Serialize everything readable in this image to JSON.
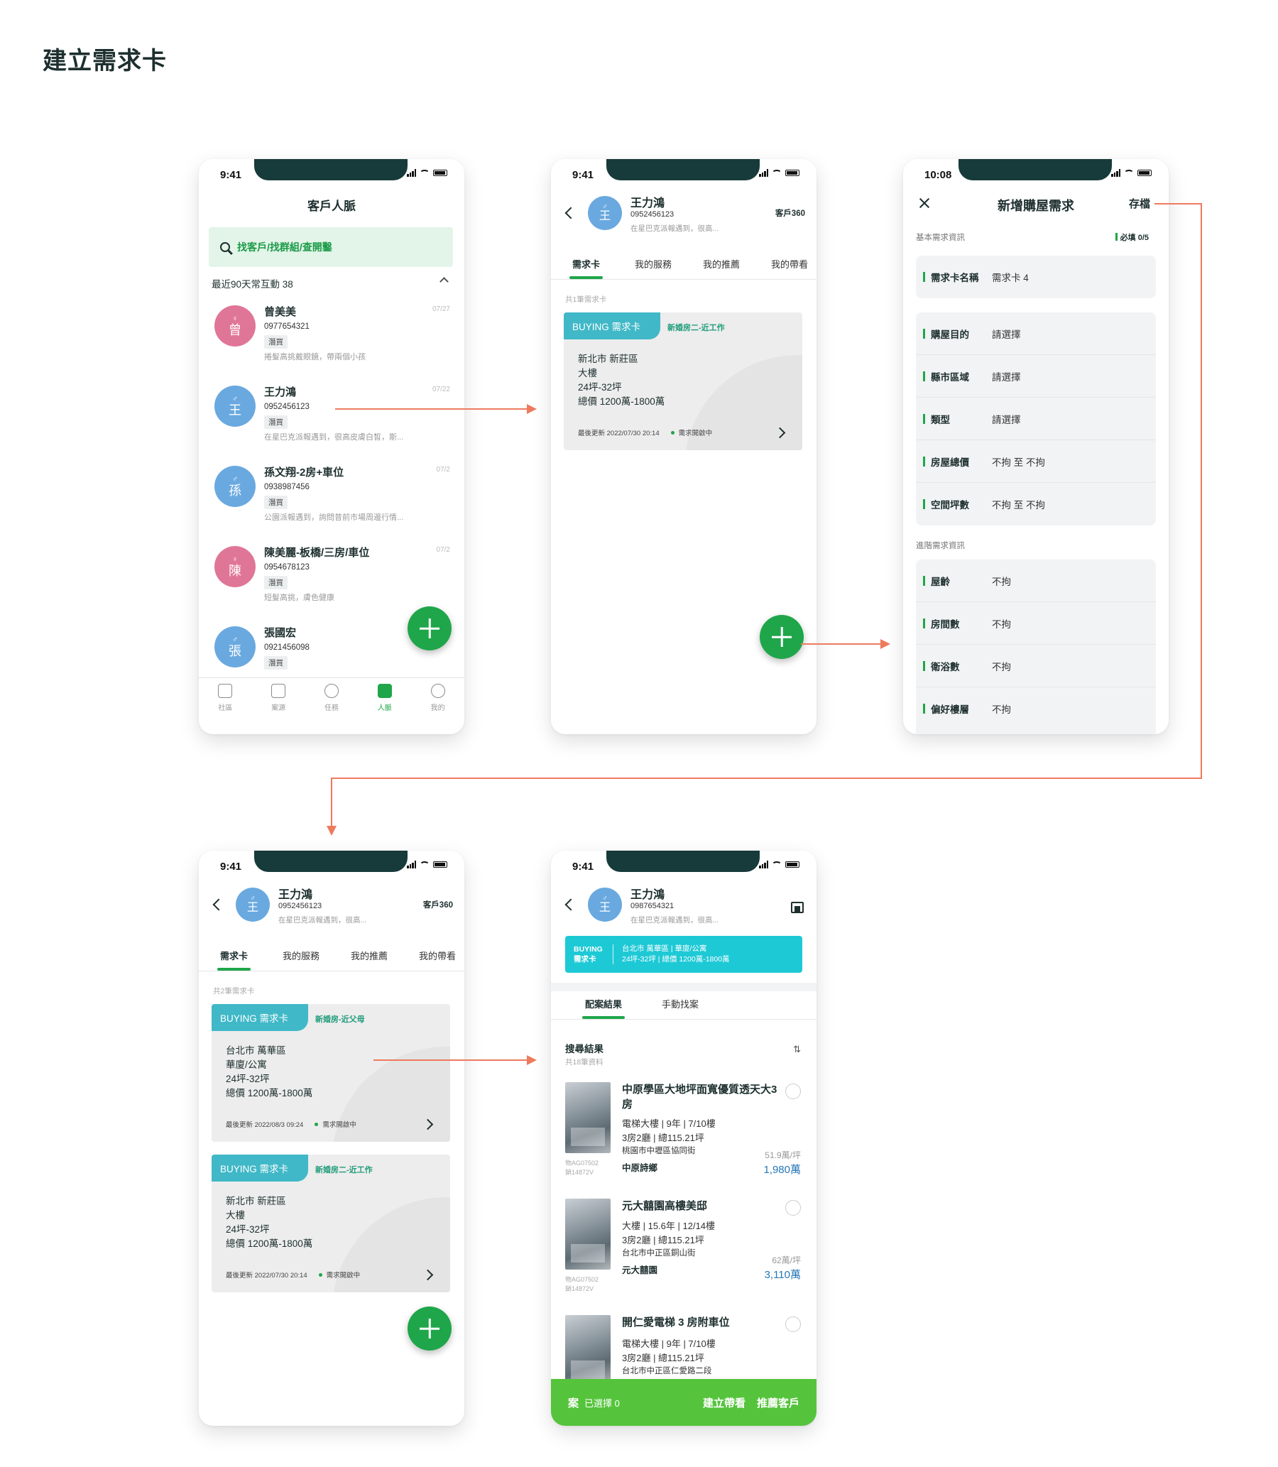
{
  "page": {
    "title": "建立需求卡"
  },
  "status": {
    "time_a": "9:41",
    "time_b": "10:08"
  },
  "screen1": {
    "title": "客戶人脈",
    "search_placeholder": "找客戶/找群組/查開鑿",
    "section": "最近90天常互動 38",
    "customers": [
      {
        "gender": "♀",
        "initial": "曾",
        "name": "曾美美",
        "phone": "0977654321",
        "tag": "潛買",
        "note": "捲髮高挑戴眼鏡，帶兩個小孩",
        "date": "07/27",
        "color": "pink"
      },
      {
        "gender": "♂",
        "initial": "王",
        "name": "王力鴻",
        "phone": "0952456123",
        "tag": "潛買",
        "note": "在星巴克派報遇到，很高皮膚白皙，斯...",
        "date": "07/22",
        "color": "blue"
      },
      {
        "gender": "♂",
        "initial": "孫",
        "name": "孫文翔-2房+車位",
        "phone": "0938987456",
        "tag": "潛買",
        "note": "公園派報遇到，詢問昔前市場周邊行情...",
        "date": "07/2",
        "color": "blue"
      },
      {
        "gender": "♀",
        "initial": "陳",
        "name": "陳美麗-板橋/三房/車位",
        "phone": "0954678123",
        "tag": "潛買",
        "note": "短髮高挑，膚色健康",
        "date": "07/2",
        "color": "pink"
      },
      {
        "gender": "♂",
        "initial": "張",
        "name": "張國宏",
        "phone": "0921456098",
        "tag": "潛買",
        "note": "",
        "date": "",
        "color": "blue"
      }
    ],
    "tabbar": [
      "社區",
      "案源",
      "任務",
      "人脈",
      "我的"
    ]
  },
  "detail": {
    "gender": "♂",
    "initial": "王",
    "name": "王力鴻",
    "phone": "0952456123",
    "phone_alt": "0987654321",
    "note": "在星巴克派報遇到，很高...",
    "badge": "客戶360",
    "tabs": [
      "需求卡",
      "我的服務",
      "我的推薦",
      "我的帶看"
    ],
    "count_1": "共1筆需求卡",
    "count_2": "共2筆需求卡"
  },
  "cards": {
    "label": "BUYING 需求卡",
    "card_a": {
      "tag": "新婚房二-近工作",
      "lines": [
        "新北市 新莊區",
        "大樓",
        "24坪-32坪",
        "總價 1200萬-1800萬"
      ],
      "updated": "最後更新 2022/07/30 20:14",
      "status": "需求開啟中"
    },
    "card_b": {
      "tag": "新婚房-近父母",
      "lines": [
        "台北市 萬華區",
        "華廈/公寓",
        "24坪-32坪",
        "總價 1200萬-1800萬"
      ],
      "updated": "最後更新 2022/08/3 09:24",
      "status": "需求開啟中"
    }
  },
  "form": {
    "title": "新增購屋需求",
    "save": "存檔",
    "basic": "基本需求資訊",
    "required": "必填 0/5",
    "card_name_label": "需求卡名稱",
    "card_name_value": "需求卡 4",
    "basic_rows": [
      {
        "label": "購屋目的",
        "value": "請選擇"
      },
      {
        "label": "縣市區域",
        "value": "請選擇"
      },
      {
        "label": "類型",
        "value": "請選擇"
      },
      {
        "label": "房屋總價",
        "value": "不拘 至 不拘"
      },
      {
        "label": "空間坪數",
        "value": "不拘 至 不拘"
      }
    ],
    "advanced": "進階需求資訊",
    "advanced_rows": [
      {
        "label": "屋齡",
        "value": "不拘"
      },
      {
        "label": "房間數",
        "value": "不拘"
      },
      {
        "label": "衛浴數",
        "value": "不拘"
      },
      {
        "label": "偏好樓層",
        "value": "不拘"
      }
    ]
  },
  "match": {
    "banner_left_1": "BUYING",
    "banner_left_2": "需求卡",
    "banner_right_1": "台北市 萬華區 | 華廈/公寓",
    "banner_right_2": "24坪-32坪 | 總價 1200萬-1800萬",
    "tabs": [
      "配案結果",
      "手動找案"
    ],
    "result_title": "搜尋結果",
    "result_count": "共18筆資料",
    "sort_icon": "⇅",
    "listings": [
      {
        "title": "中原學區大地坪面寬優質透天大3房",
        "meta1": "電梯大樓 | 9年 | 7/10樓",
        "meta2": "3房2廳 | 總115.21坪",
        "addr": "桃園市中壢區協同街",
        "agent": "中原詩鄉",
        "unit": "51.9萬/坪",
        "price": "1,980萬",
        "code1": "物AG07502",
        "code2": "銷14872V"
      },
      {
        "title": "元大囍園高樓美邸",
        "meta1": "大樓 | 15.6年 | 12/14樓",
        "meta2": "3房2廳 | 總115.21坪",
        "addr": "台北市中正區銅山街",
        "agent": "元大囍園",
        "unit": "62萬/坪",
        "price": "3,110萬",
        "code1": "物AG07502",
        "code2": "銷14872V"
      },
      {
        "title": "開仁愛電梯 3 房附車位",
        "meta1": "電梯大樓 | 9年 | 7/10樓",
        "meta2": "3房2廳 | 總115.21坪",
        "addr": "台北市中正區仁愛路二段",
        "agent": "",
        "unit": "",
        "price": "",
        "code1": "",
        "code2": ""
      }
    ],
    "bottom_icon": "案",
    "bottom_selected": "已選擇 0",
    "action_1": "建立帶看",
    "action_2": "推薦客戶"
  }
}
